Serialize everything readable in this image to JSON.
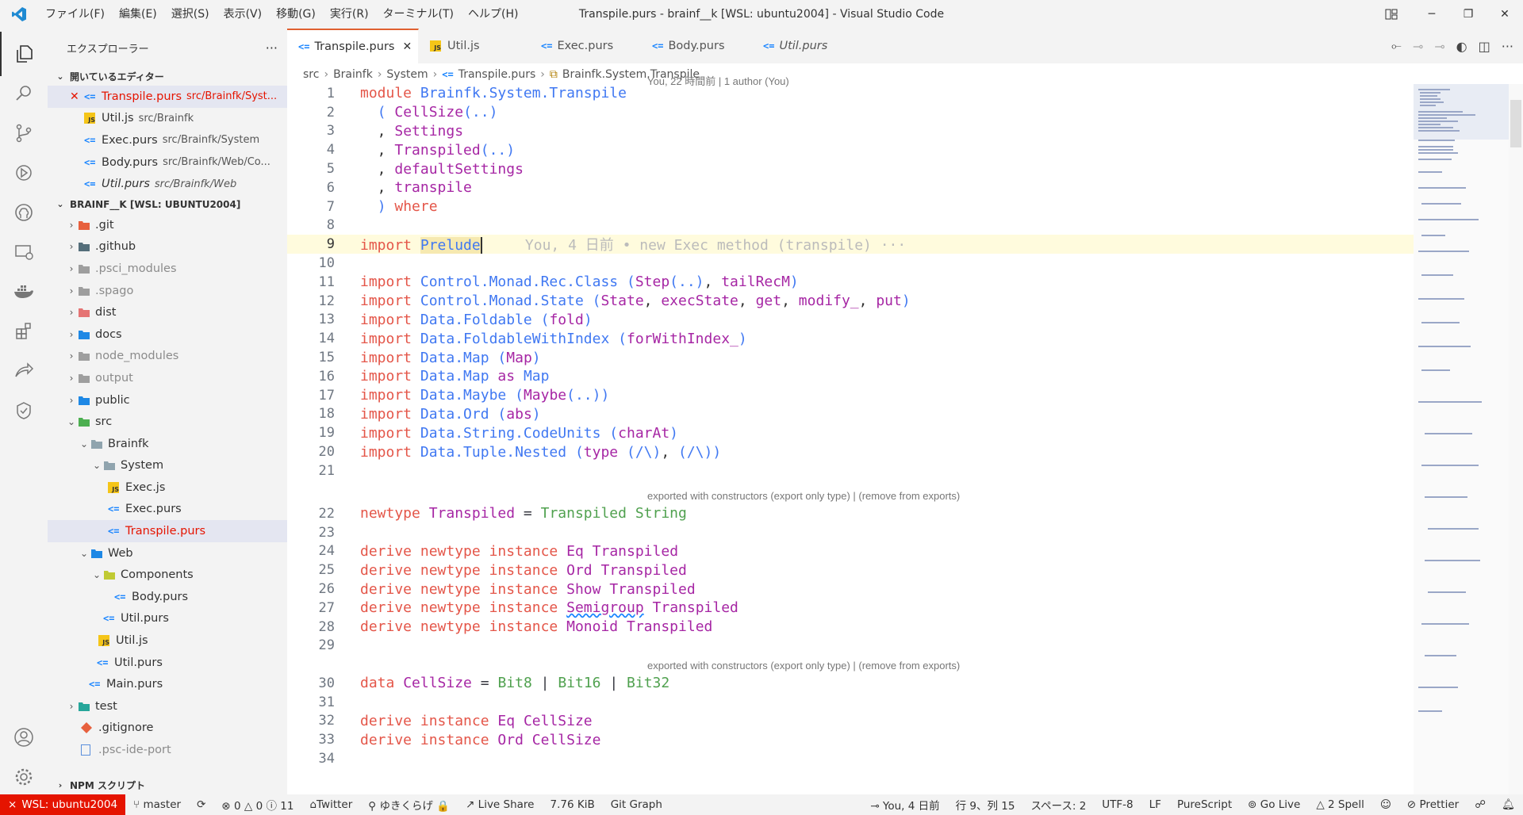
{
  "window": {
    "title": "Transpile.purs - brainf__k [WSL: ubuntu2004] - Visual Studio Code",
    "menu": [
      "ファイル(F)",
      "編集(E)",
      "選択(S)",
      "表示(V)",
      "移動(G)",
      "実行(R)",
      "ターミナル(T)",
      "ヘルプ(H)"
    ]
  },
  "sidebar": {
    "title": "エクスプローラー",
    "more": "···",
    "open_editors_title": "開いているエディター",
    "open_editors": [
      {
        "name": "Transpile.purs",
        "path": "src/Brainfk/Syst...",
        "icon": "purs"
      },
      {
        "name": "Util.js",
        "path": "src/Brainfk",
        "icon": "js"
      },
      {
        "name": "Exec.purs",
        "path": "src/Brainfk/System",
        "icon": "purs"
      },
      {
        "name": "Body.purs",
        "path": "src/Brainfk/Web/Co...",
        "icon": "purs"
      },
      {
        "name": "Util.purs",
        "path": "src/Brainfk/Web",
        "icon": "purs"
      }
    ],
    "workspace_title": "BRAINF__K [WSL: UBUNTU2004]",
    "tree": [
      {
        "name": ".git"
      },
      {
        "name": ".github"
      },
      {
        "name": ".psci_modules"
      },
      {
        "name": ".spago"
      },
      {
        "name": "dist"
      },
      {
        "name": "docs"
      },
      {
        "name": "node_modules"
      },
      {
        "name": "output"
      },
      {
        "name": "public"
      },
      {
        "name": "src"
      },
      {
        "name": "Brainfk"
      },
      {
        "name": "System"
      },
      {
        "name": "Exec.js"
      },
      {
        "name": "Exec.purs"
      },
      {
        "name": "Transpile.purs"
      },
      {
        "name": "Web"
      },
      {
        "name": "Components"
      },
      {
        "name": "Body.purs"
      },
      {
        "name": "Util.purs"
      },
      {
        "name": "Util.js"
      },
      {
        "name": "Util.purs"
      },
      {
        "name": "Main.purs"
      },
      {
        "name": "test"
      },
      {
        "name": ".gitignore"
      },
      {
        "name": ".psc-ide-port"
      }
    ],
    "npm_title": "NPM スクリプト"
  },
  "tabs": [
    {
      "label": "Transpile.purs",
      "icon": "purs"
    },
    {
      "label": "Util.js",
      "icon": "js"
    },
    {
      "label": "Exec.purs",
      "icon": "purs"
    },
    {
      "label": "Body.purs",
      "icon": "purs"
    },
    {
      "label": "Util.purs",
      "icon": "purs"
    }
  ],
  "breadcrumb": [
    "src",
    "Brainfk",
    "System",
    "Transpile.purs",
    "Brainfk.System.Transpile"
  ],
  "editor": {
    "blame_header": "You, 22 時間前 | 1 author (You)",
    "inline_blame": "You, 4 日前 • new Exec method (transpile) ···",
    "lens_1": "exported with constructors (export only type) | (remove from exports)",
    "lens_2": "exported with constructors (export only type) | (remove from exports)",
    "line_numbers": [
      "1",
      "2",
      "3",
      "4",
      "5",
      "6",
      "7",
      "8",
      "9",
      "10",
      "11",
      "12",
      "13",
      "14",
      "15",
      "16",
      "17",
      "18",
      "19",
      "20",
      "21",
      "22",
      "23",
      "24",
      "25",
      "26",
      "27",
      "28",
      "29",
      "30",
      "31",
      "32",
      "33",
      "34"
    ]
  },
  "statusbar": {
    "remote": "WSL: ubuntu2004",
    "branch": "master",
    "problems": "0",
    "warnings": "0",
    "info": "11",
    "twitter": "Twitter",
    "user": "ゆきくらげ 🔒",
    "live_share": "Live Share",
    "size": "7.76 KiB",
    "git_graph": "Git Graph",
    "blame": "You, 4 日前",
    "position": "行 9、列 15",
    "spaces": "スペース: 2",
    "encoding": "UTF-8",
    "eol": "LF",
    "language": "PureScript",
    "go_live": "Go Live",
    "spell": "2 Spell",
    "prettier": "Prettier"
  }
}
